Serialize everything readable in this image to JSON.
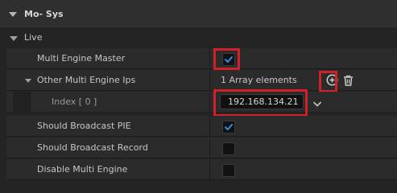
{
  "section": {
    "title": "Mo- Sys"
  },
  "category": {
    "title": "Live"
  },
  "rows": {
    "multi_engine_master": {
      "label": "Multi Engine Master",
      "checked": true
    },
    "other_ips": {
      "label": "Other Multi Engine Ips",
      "value": "1 Array elements"
    },
    "index0": {
      "label": "Index [ 0 ]",
      "value": "192.168.134.21"
    },
    "broadcast_pie": {
      "label": "Should Broadcast PIE",
      "checked": true
    },
    "broadcast_record": {
      "label": "Should Broadcast Record",
      "checked": false
    },
    "disable_multi_engine": {
      "label": "Disable Multi Engine",
      "checked": false
    }
  },
  "colors": {
    "highlight": "#d0202a",
    "check": "#2f8fe8"
  },
  "icons": [
    "expand-triangle-icon",
    "checkmark-icon",
    "add-element-icon",
    "trash-icon",
    "chevron-down-icon"
  ]
}
